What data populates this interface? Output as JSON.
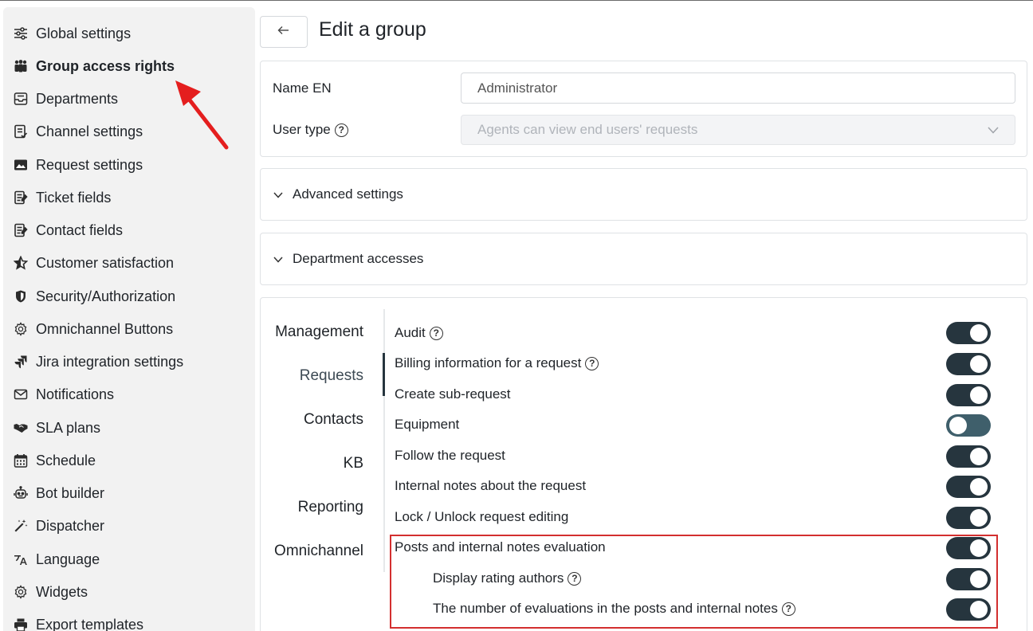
{
  "sidebar": {
    "items": [
      {
        "label": "Global settings",
        "icon": "sliders-icon"
      },
      {
        "label": "Group access rights",
        "icon": "group-icon",
        "active": true
      },
      {
        "label": "Departments",
        "icon": "inbox-icon"
      },
      {
        "label": "Channel settings",
        "icon": "clipboard-icon"
      },
      {
        "label": "Request settings",
        "icon": "image-icon"
      },
      {
        "label": "Ticket fields",
        "icon": "form-icon"
      },
      {
        "label": "Contact fields",
        "icon": "form-icon"
      },
      {
        "label": "Customer satisfaction",
        "icon": "star-icon"
      },
      {
        "label": "Security/Authorization",
        "icon": "shield-icon"
      },
      {
        "label": "Omnichannel Buttons",
        "icon": "gear-icon"
      },
      {
        "label": "Jira integration settings",
        "icon": "jira-icon"
      },
      {
        "label": "Notifications",
        "icon": "envelope-icon"
      },
      {
        "label": "SLA plans",
        "icon": "handshake-icon"
      },
      {
        "label": "Schedule",
        "icon": "calendar-icon"
      },
      {
        "label": "Bot builder",
        "icon": "robot-icon"
      },
      {
        "label": "Dispatcher",
        "icon": "wand-icon"
      },
      {
        "label": "Language",
        "icon": "translate-icon"
      },
      {
        "label": "Widgets",
        "icon": "gear-icon"
      },
      {
        "label": "Export templates",
        "icon": "printer-icon"
      }
    ]
  },
  "header": {
    "back_icon": "arrow-left-icon",
    "title": "Edit a group"
  },
  "name_card": {
    "name_label": "Name EN",
    "name_value": "Administrator",
    "user_type_label": "User type",
    "user_type_value": "Agents can view end users' requests"
  },
  "advanced": {
    "label": "Advanced settings"
  },
  "departments": {
    "label": "Department accesses"
  },
  "permissions": {
    "tabs": [
      "Management",
      "Requests",
      "Contacts",
      "KB",
      "Reporting",
      "Omnichannel"
    ],
    "active_tab": "Requests",
    "rows": [
      {
        "label": "Audit",
        "help": true,
        "on": true,
        "sub": false
      },
      {
        "label": "Billing information for a request",
        "help": true,
        "on": true,
        "sub": false
      },
      {
        "label": "Create sub-request",
        "help": false,
        "on": true,
        "sub": false
      },
      {
        "label": "Equipment",
        "help": false,
        "on": false,
        "sub": false
      },
      {
        "label": "Follow the request",
        "help": false,
        "on": true,
        "sub": false
      },
      {
        "label": "Internal notes about the request",
        "help": false,
        "on": true,
        "sub": false
      },
      {
        "label": "Lock / Unlock request editing",
        "help": false,
        "on": true,
        "sub": false
      },
      {
        "label": "Posts and internal notes evaluation",
        "help": false,
        "on": true,
        "sub": false
      },
      {
        "label": "Display rating authors",
        "help": true,
        "on": true,
        "sub": true
      },
      {
        "label": "The number of evaluations in the posts and internal notes",
        "help": true,
        "on": true,
        "sub": true
      }
    ]
  },
  "colors": {
    "toggle_on": "#26353e",
    "toggle_off": "#3f5f6b",
    "highlight": "#d32f2f",
    "arrow": "#e41e1e"
  }
}
